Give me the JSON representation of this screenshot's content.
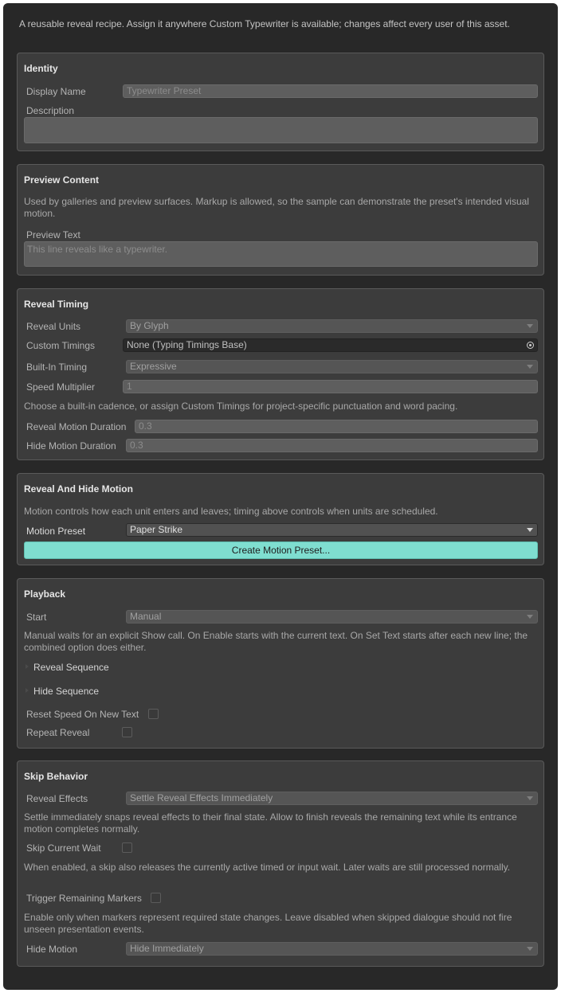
{
  "intro": "A reusable reveal recipe. Assign it anywhere Custom Typewriter is available; changes affect every user of this asset.",
  "identity": {
    "title": "Identity",
    "display_name_label": "Display Name",
    "display_name_value": "Typewriter Preset",
    "description_label": "Description",
    "description_value": ""
  },
  "preview": {
    "title": "Preview Content",
    "help": "Used by galleries and preview surfaces. Markup is allowed, so the sample can demonstrate the preset's intended visual motion.",
    "text_label": "Preview Text",
    "text_value": "This line reveals like a typewriter."
  },
  "timing": {
    "title": "Reveal Timing",
    "reveal_units_label": "Reveal Units",
    "reveal_units_value": "By Glyph",
    "custom_timings_label": "Custom Timings",
    "custom_timings_value": "None (Typing Timings Base)",
    "builtin_timing_label": "Built-In Timing",
    "builtin_timing_value": "Expressive",
    "speed_label": "Speed Multiplier",
    "speed_value": "1",
    "help": "Choose a built-in cadence, or assign Custom Timings for project-specific punctuation and word pacing.",
    "reveal_duration_label": "Reveal Motion Duration",
    "reveal_duration_value": "0.3",
    "hide_duration_label": "Hide Motion Duration",
    "hide_duration_value": "0.3"
  },
  "motion": {
    "title": "Reveal And Hide Motion",
    "help": "Motion controls how each unit enters and leaves; timing above controls when units are scheduled.",
    "preset_label": "Motion Preset",
    "preset_value": "Paper Strike",
    "create_button": "Create Motion Preset..."
  },
  "playback": {
    "title": "Playback",
    "start_label": "Start",
    "start_value": "Manual",
    "help": "Manual waits for an explicit Show call. On Enable starts with the current text. On Set Text starts after each new line; the combined option does either.",
    "reveal_sequence": "Reveal Sequence",
    "hide_sequence": "Hide Sequence",
    "reset_speed_label": "Reset Speed On New Text",
    "repeat_reveal_label": "Repeat Reveal"
  },
  "skip": {
    "title": "Skip Behavior",
    "reveal_effects_label": "Reveal Effects",
    "reveal_effects_value": "Settle Reveal Effects Immediately",
    "help1": "Settle immediately snaps reveal effects to their final state. Allow to finish reveals the remaining text while its entrance motion completes normally.",
    "skip_wait_label": "Skip Current Wait",
    "help2": "When enabled, a skip also releases the currently active timed or input wait. Later waits are still processed normally.",
    "trigger_markers_label": "Trigger Remaining Markers",
    "help3": "Enable only when markers represent required state changes. Leave disabled when skipped dialogue should not fire unseen presentation events.",
    "hide_motion_label": "Hide Motion",
    "hide_motion_value": "Hide Immediately"
  }
}
